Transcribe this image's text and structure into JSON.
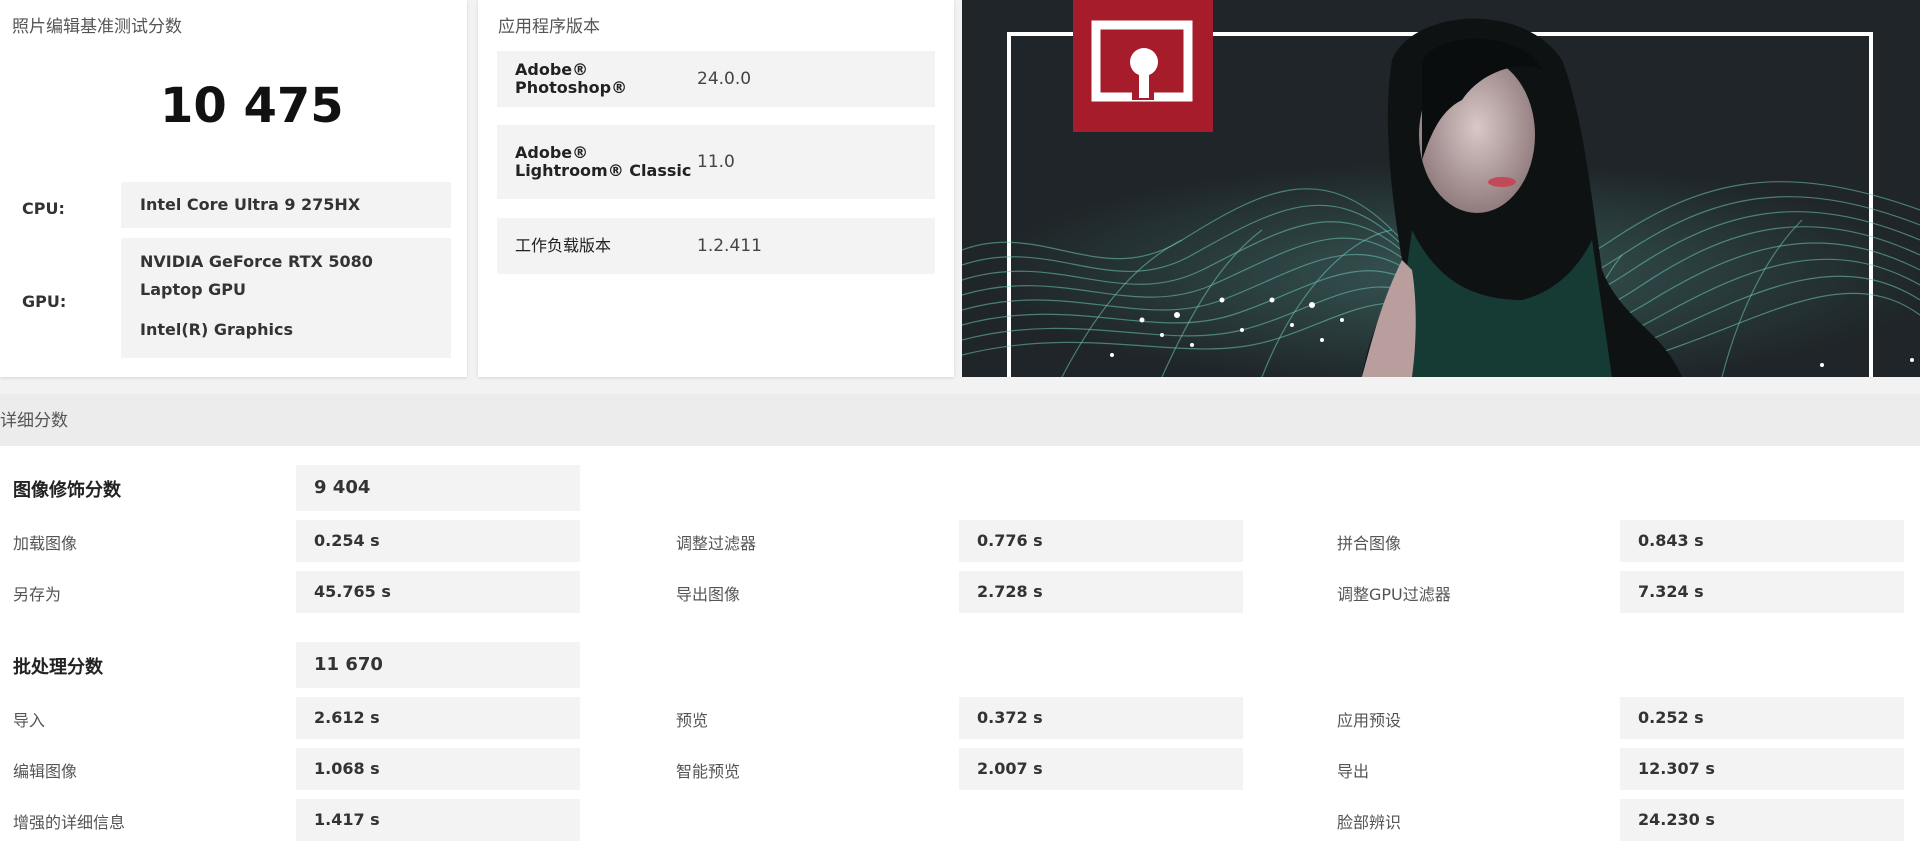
{
  "score_card": {
    "title": "照片编辑基准测试分数",
    "score": "10 475",
    "cpu_label": "CPU:",
    "cpu_value": "Intel Core Ultra 9 275HX",
    "gpu_label": "GPU:",
    "gpu_value_1": "NVIDIA GeForce RTX 5080 Laptop GPU",
    "gpu_value_2": "Intel(R) Graphics"
  },
  "app_card": {
    "title": "应用程序版本",
    "rows": [
      {
        "name": "Adobe® Photoshop®",
        "version": "24.0.0"
      },
      {
        "name": "Adobe® Lightroom® Classic",
        "version": "11.0"
      },
      {
        "name": "工作负载版本",
        "version": "1.2.411"
      }
    ]
  },
  "hero": {
    "logo_icon": "procyon-photo-logo-icon",
    "brand_color": "#a61c2b"
  },
  "details": {
    "header": "详细分数",
    "image_retouching": {
      "label": "图像修饰分数",
      "score": "9 404",
      "items": [
        {
          "label": "加载图像",
          "value": "0.254 s"
        },
        {
          "label": "调整过滤器",
          "value": "0.776 s"
        },
        {
          "label": "拼合图像",
          "value": "0.843 s"
        },
        {
          "label": "另存为",
          "value": "45.765 s"
        },
        {
          "label": "导出图像",
          "value": "2.728 s"
        },
        {
          "label": "调整GPU过滤器",
          "value": "7.324 s"
        }
      ]
    },
    "batch_processing": {
      "label": "批处理分数",
      "score": "11 670",
      "items": [
        {
          "label": "导入",
          "value": "2.612 s"
        },
        {
          "label": "预览",
          "value": "0.372 s"
        },
        {
          "label": "应用预设",
          "value": "0.252 s"
        },
        {
          "label": "编辑图像",
          "value": "1.068 s"
        },
        {
          "label": "智能预览",
          "value": "2.007 s"
        },
        {
          "label": "导出",
          "value": "12.307 s"
        },
        {
          "label": "增强的详细信息",
          "value": "1.417 s"
        },
        {
          "label": "脸部辨识",
          "value": "24.230 s"
        }
      ]
    }
  }
}
